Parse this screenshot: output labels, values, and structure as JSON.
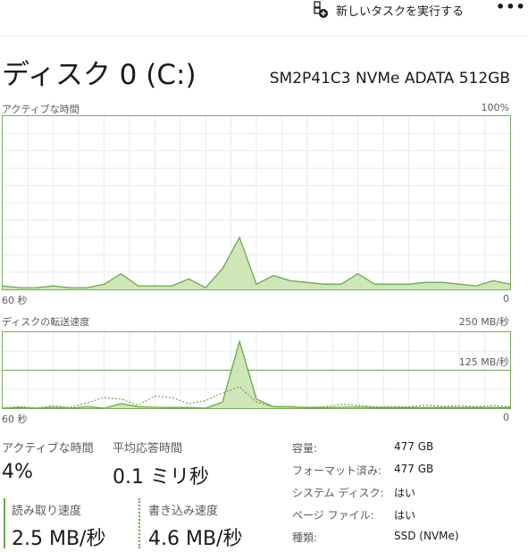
{
  "toolbar": {
    "new_task_label": "新しいタスクを実行する",
    "more_label": "•••",
    "new_task_icon": "new-task-icon"
  },
  "header": {
    "title": "ディスク 0 (C:)",
    "model": "SM2P41C3 NVMe ADATA 512GB"
  },
  "active_chart": {
    "label": "アクティブな時間",
    "max_label": "100%",
    "x_left": "60 秒",
    "x_right": "0"
  },
  "transfer_chart": {
    "label": "ディスクの転送速度",
    "max_label": "250 MB/秒",
    "mid_label": "125 MB/秒",
    "x_left": "60 秒",
    "x_right": "0"
  },
  "stats": {
    "active_label": "アクティブな時間",
    "active_value": "4%",
    "response_label": "平均応答時間",
    "response_value": "0.1 ミリ秒",
    "read_label": "読み取り速度",
    "read_value": "2.5 MB/秒",
    "write_label": "書き込み速度",
    "write_value": "4.6 MB/秒"
  },
  "properties": [
    {
      "key": "容量:",
      "value": "477 GB"
    },
    {
      "key": "フォーマット済み:",
      "value": "477 GB"
    },
    {
      "key": "システム ディスク:",
      "value": "はい"
    },
    {
      "key": "ページ ファイル:",
      "value": "はい"
    },
    {
      "key": "種類:",
      "value": "SSD (NVMe)"
    }
  ],
  "colors": {
    "line": "#6aa84f",
    "fill": "#cfe6b8",
    "grid": "#eaeaea",
    "border": "#7eaa55"
  },
  "chart_data": [
    {
      "type": "area",
      "title": "アクティブな時間",
      "ylim": [
        0,
        100
      ],
      "unit": "%",
      "x": [
        60,
        58,
        56,
        54,
        52,
        50,
        48,
        46,
        44,
        42,
        40,
        38,
        36,
        34,
        32,
        30,
        28,
        26,
        24,
        22,
        20,
        18,
        16,
        14,
        12,
        10,
        8,
        6,
        4,
        2,
        0
      ],
      "values": [
        2,
        1,
        1,
        2,
        1,
        1,
        3,
        9,
        2,
        2,
        2,
        6,
        1,
        12,
        30,
        3,
        8,
        5,
        4,
        3,
        3,
        9,
        3,
        3,
        3,
        4,
        4,
        3,
        2,
        5,
        3
      ]
    },
    {
      "type": "line",
      "title": "ディスクの転送速度",
      "ylim": [
        0,
        250
      ],
      "unit": "MB/秒",
      "x": [
        60,
        58,
        56,
        54,
        52,
        50,
        48,
        46,
        44,
        42,
        40,
        38,
        36,
        34,
        32,
        30,
        28,
        26,
        24,
        22,
        20,
        18,
        16,
        14,
        12,
        10,
        8,
        6,
        4,
        2,
        0
      ],
      "series": [
        {
          "values": [
            0,
            2,
            0,
            3,
            0,
            5,
            0,
            15,
            5,
            3,
            2,
            2,
            0,
            20,
            220,
            30,
            5,
            4,
            2,
            2,
            3,
            4,
            2,
            2,
            2,
            2,
            2,
            2,
            2,
            2,
            2
          ]
        },
        {
          "values": [
            0,
            5,
            0,
            8,
            3,
            18,
            35,
            30,
            10,
            40,
            35,
            15,
            25,
            50,
            70,
            20,
            5,
            6,
            3,
            4,
            12,
            10,
            4,
            5,
            4,
            10,
            6,
            8,
            5,
            9,
            5
          ]
        }
      ]
    }
  ]
}
